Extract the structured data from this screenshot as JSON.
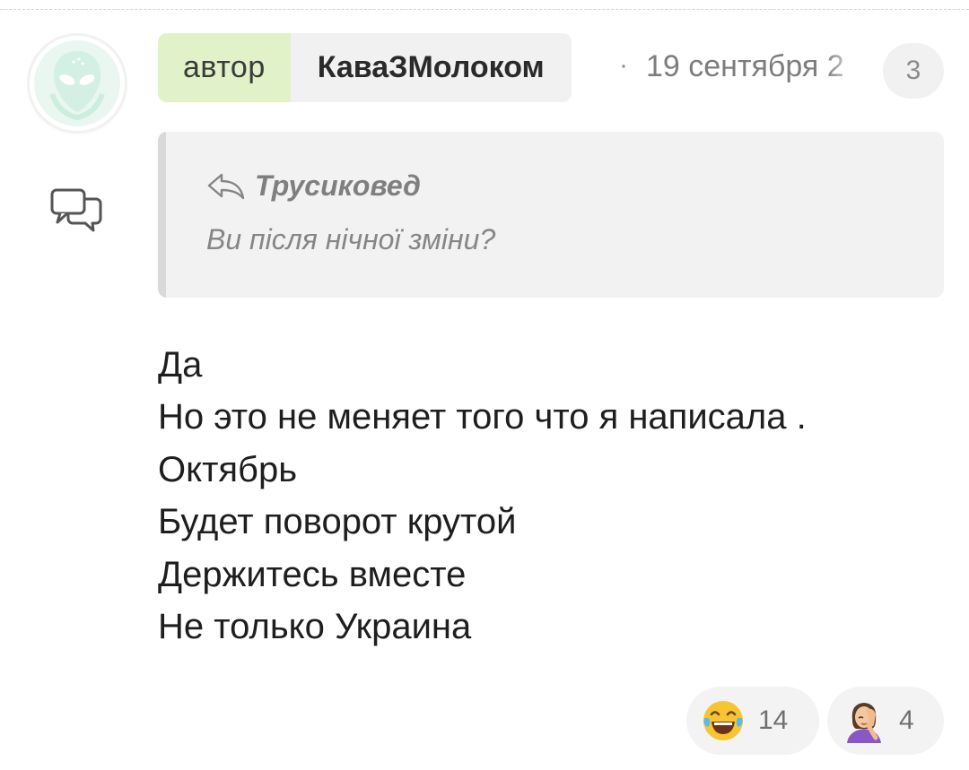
{
  "comment": {
    "author_tag": "автор",
    "author_name": "КаваЗМолоком",
    "separator": "·",
    "date": "19 сентября 2",
    "reply_count": "3",
    "icons": {
      "avatar": "alien-avatar-icon",
      "reply": "speech-bubbles-icon",
      "quote_arrow": "reply-arrow-icon"
    },
    "quote": {
      "author": "Трусиковед",
      "text": "Ви після нічної зміни?"
    },
    "message_lines": [
      "Да",
      "Но это не меняет того что я написала .",
      "Октябрь",
      "Будет поворот крутой",
      "Держитесь вместе",
      "Не только Украина"
    ],
    "reactions": [
      {
        "icon": "laughing-tears-emoji-icon",
        "count": "14"
      },
      {
        "icon": "facepalm-woman-emoji-icon",
        "count": "4"
      }
    ]
  },
  "colors": {
    "author_tag_bg": "#e1f2c9",
    "chip_bg": "#f1f1f1",
    "quote_bg": "#f2f2f2",
    "avatar_accent": "#bfe6d6"
  }
}
